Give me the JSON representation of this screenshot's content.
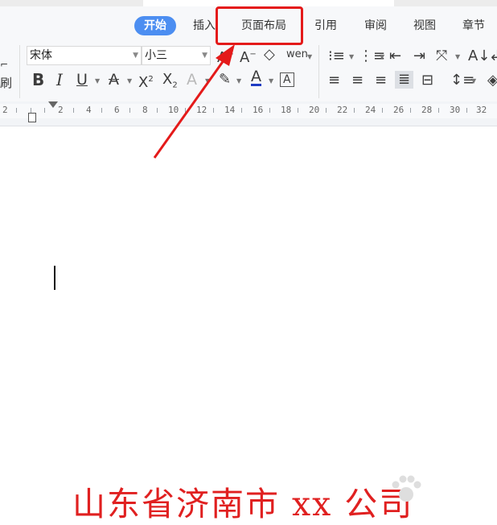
{
  "tabs": [
    "开始",
    "插入",
    "页面布局",
    "引用",
    "审阅",
    "视图",
    "章节"
  ],
  "font_name": "宋体",
  "font_size": "小三",
  "left_partial_label": "刷",
  "ruler_labels": [
    "2",
    "2",
    "4",
    "6",
    "8",
    "10",
    "12",
    "14",
    "16",
    "18",
    "20",
    "22",
    "24",
    "26",
    "28",
    "30",
    "32"
  ],
  "caption": "山东省济南市 xx 公司",
  "colors": {
    "accent": "#4c8ef1",
    "highlight": "#e41a1a",
    "caption": "#e02020",
    "font_color_underline": "#1f3cc4"
  }
}
